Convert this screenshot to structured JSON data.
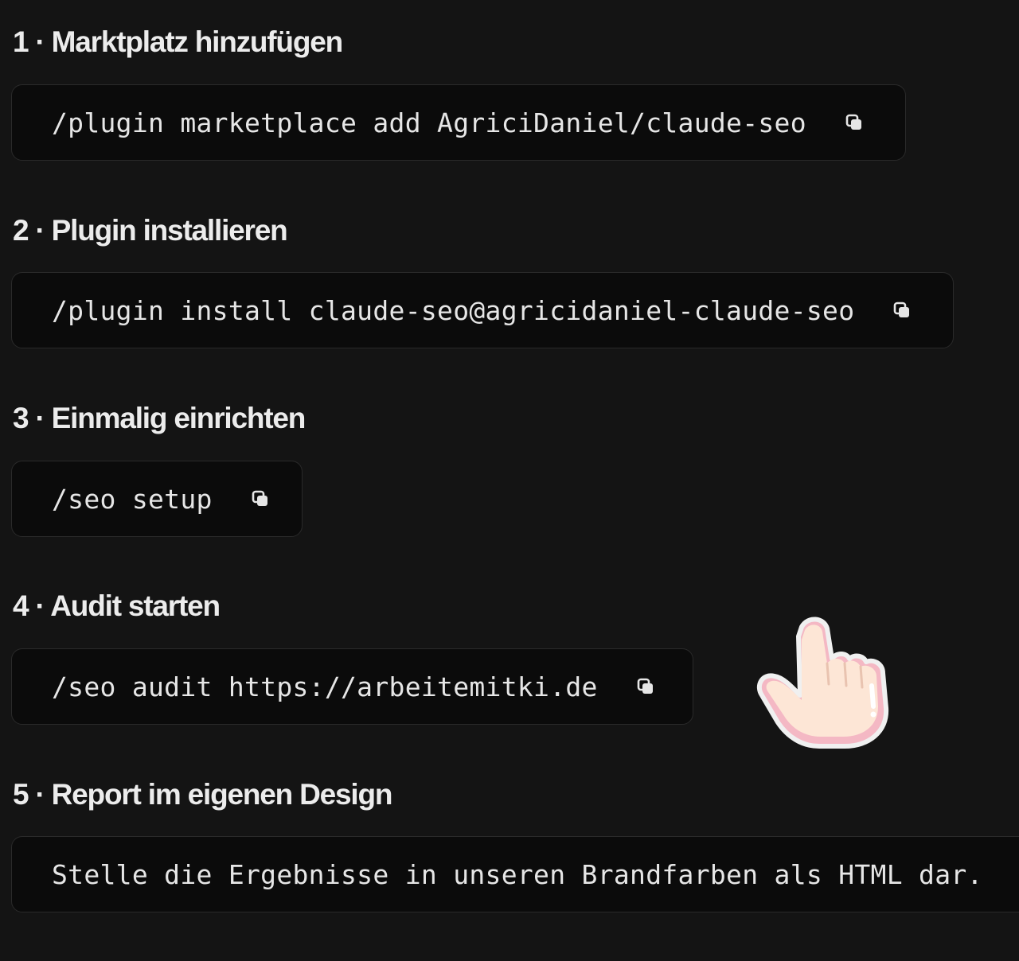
{
  "steps": [
    {
      "heading": "1 · Marktplatz hinzufügen",
      "command": "/plugin marketplace add AgriciDaniel/claude-seo",
      "copy_icon": "copy-icon"
    },
    {
      "heading": "2 · Plugin installieren",
      "command": "/plugin install claude-seo@agricidaniel-claude-seo",
      "copy_icon": "copy-icon"
    },
    {
      "heading": "3 · Einmalig einrichten",
      "command": "/seo setup",
      "copy_icon": "copy-icon"
    },
    {
      "heading": "4 · Audit starten",
      "command": "/seo audit https://arbeitemitki.de",
      "copy_icon": "copy-icon"
    },
    {
      "heading": "5 · Report im eigenen Design",
      "command": "Stelle die Ergebnisse in unseren Brandfarben als HTML dar."
    }
  ],
  "cursor_icon": "pointing-hand-icon",
  "colors": {
    "background": "#141414",
    "code_background": "#0b0b0b",
    "code_border": "#2a2a2a",
    "text": "#ececec",
    "hand_skin": "#fbe3d3",
    "hand_outline": "#f2b7c1"
  }
}
